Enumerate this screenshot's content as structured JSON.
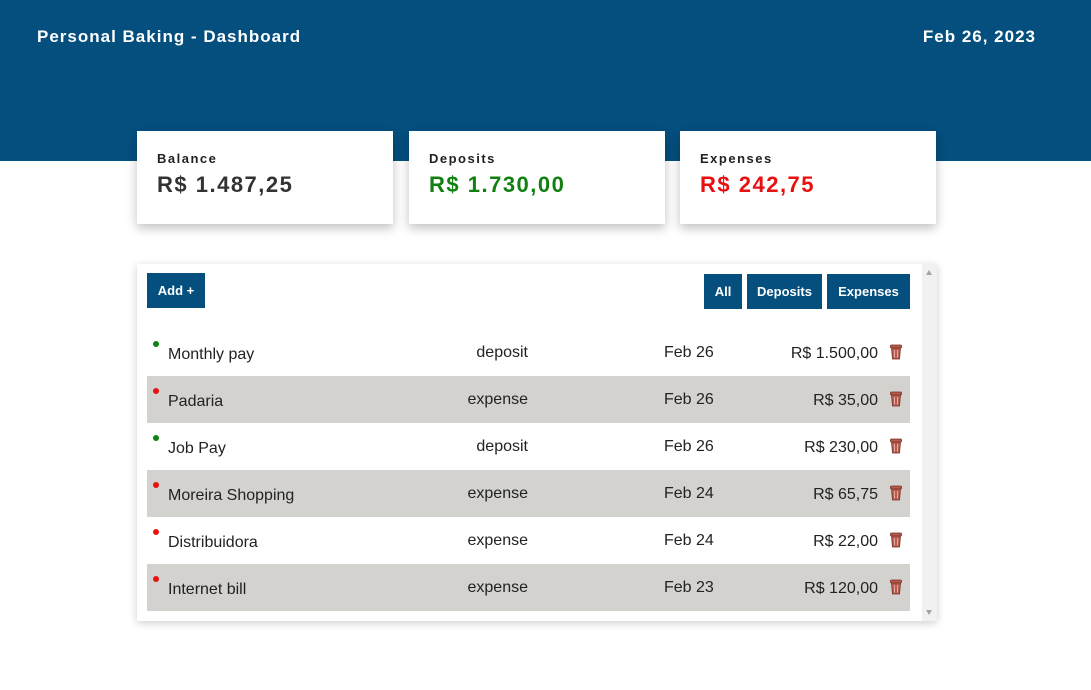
{
  "header": {
    "title": "Personal Baking - Dashboard",
    "date": "Feb 26, 2023"
  },
  "cards": {
    "balance": {
      "label": "Balance",
      "amount": "R$ 1.487,25",
      "color": "#333333"
    },
    "deposits": {
      "label": "Deposits",
      "amount": "R$ 1.730,00",
      "color": "#108010"
    },
    "expenses": {
      "label": "Expenses",
      "amount": "R$ 242,75",
      "color": "#e81010"
    }
  },
  "toolbar": {
    "add_label": "Add +",
    "filter_all": "All",
    "filter_deposits": "Deposits",
    "filter_expenses": "Expenses"
  },
  "transactions": [
    {
      "name": "Monthly pay",
      "type": "deposit",
      "date": "Feb 26",
      "value": "R$ 1.500,00"
    },
    {
      "name": "Padaria",
      "type": "expense",
      "date": "Feb 26",
      "value": "R$ 35,00"
    },
    {
      "name": "Job Pay",
      "type": "deposit",
      "date": "Feb 26",
      "value": "R$ 230,00"
    },
    {
      "name": "Moreira Shopping",
      "type": "expense",
      "date": "Feb 24",
      "value": "R$ 65,75"
    },
    {
      "name": "Distribuidora",
      "type": "expense",
      "date": "Feb 24",
      "value": "R$ 22,00"
    },
    {
      "name": "Internet bill",
      "type": "expense",
      "date": "Feb 23",
      "value": "R$ 120,00"
    }
  ],
  "icons": {
    "row_action": "trash-icon"
  },
  "colors": {
    "primary": "#044f7e",
    "deposit_dot": "#108010",
    "expense_dot": "#e81010",
    "row_alt": "#d3d2cf",
    "trash": "#b45a4e"
  }
}
